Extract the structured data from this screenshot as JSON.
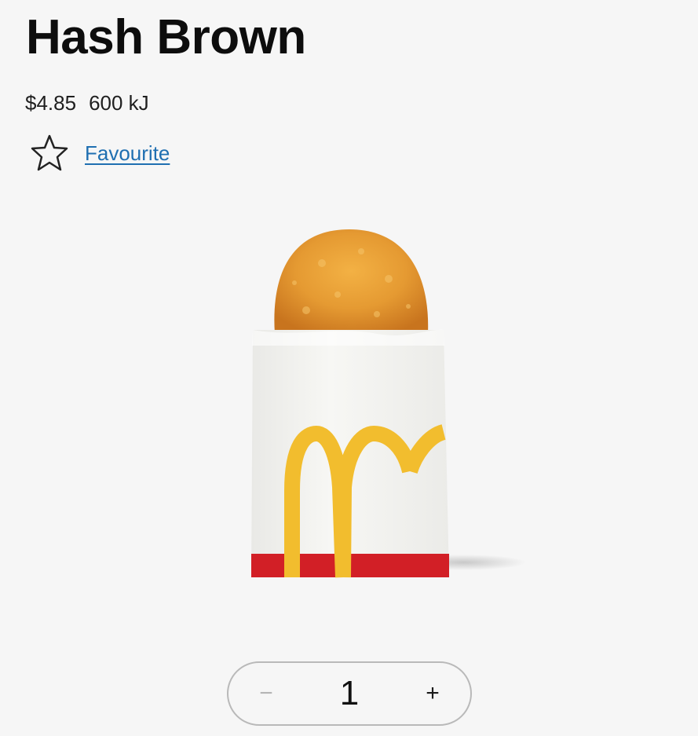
{
  "product": {
    "name": "Hash Brown",
    "price": "$4.85",
    "energy": "600 kJ"
  },
  "favourite": {
    "label": "Favourite",
    "icon": "star-outline-icon"
  },
  "image": {
    "subject": "hash-brown-in-paper-sleeve",
    "colors": {
      "sleeve": "#f4f4f1",
      "arches": "#f2bd2e",
      "stripe": "#d21f26",
      "patty": "#e0962f"
    }
  },
  "quantity": {
    "minus": "−",
    "value": "1",
    "plus": "+"
  },
  "colors": {
    "background": "#f6f6f6",
    "link": "#1f6fb1",
    "border": "#b9b9b9"
  }
}
